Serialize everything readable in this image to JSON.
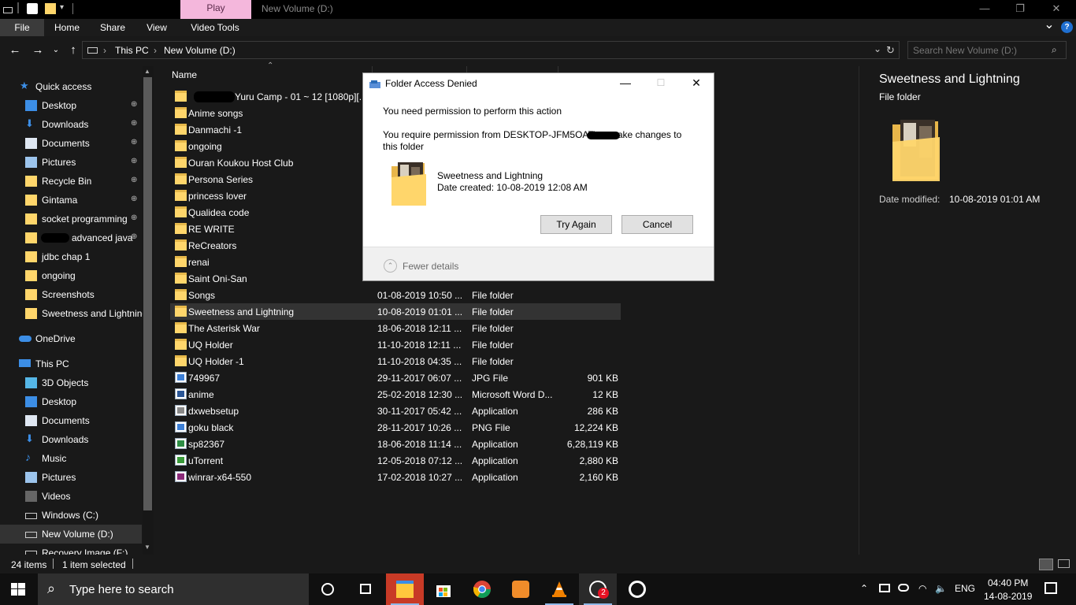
{
  "titlebar": {
    "context_tab": "Play",
    "window_title": "New Volume (D:)",
    "minimize_glyph": "—",
    "maximize_glyph": "❐",
    "close_glyph": "✕"
  },
  "ribbon": {
    "tabs": [
      "File",
      "Home",
      "Share",
      "View",
      "Video Tools"
    ],
    "expand_glyph": "⌄",
    "help_glyph": "?"
  },
  "address": {
    "crumbs": [
      "This PC",
      "New Volume (D:)"
    ],
    "separator": "›",
    "search_placeholder": "Search New Volume (D:)"
  },
  "nav": {
    "quick_access": "Quick access",
    "quick_items": [
      {
        "label": "Desktop",
        "icon": "desktop-icon"
      },
      {
        "label": "Downloads",
        "icon": "downloads-icon"
      },
      {
        "label": "Documents",
        "icon": "documents-icon"
      },
      {
        "label": "Pictures",
        "icon": "pictures-icon"
      },
      {
        "label": "Recycle Bin",
        "icon": "folder-icon"
      },
      {
        "label": "Gintama",
        "icon": "folder-icon"
      },
      {
        "label": "socket programming",
        "icon": "folder-icon"
      },
      {
        "label": "advanced java",
        "icon": "folder-icon"
      },
      {
        "label": "jdbc chap 1",
        "icon": "folder-icon"
      },
      {
        "label": "ongoing",
        "icon": "folder-icon"
      },
      {
        "label": "Screenshots",
        "icon": "folder-icon"
      },
      {
        "label": "Sweetness and Lightning",
        "icon": "folder-icon"
      }
    ],
    "onedrive": "OneDrive",
    "this_pc": "This PC",
    "pc_items": [
      {
        "label": "3D Objects",
        "icon": "3d-objects-icon"
      },
      {
        "label": "Desktop",
        "icon": "desktop-icon"
      },
      {
        "label": "Documents",
        "icon": "documents-icon"
      },
      {
        "label": "Downloads",
        "icon": "downloads-icon"
      },
      {
        "label": "Music",
        "icon": "music-icon"
      },
      {
        "label": "Pictures",
        "icon": "pictures-icon"
      },
      {
        "label": "Videos",
        "icon": "videos-icon"
      },
      {
        "label": "Windows (C:)",
        "icon": "drive-icon"
      },
      {
        "label": "New Volume (D:)",
        "icon": "drive-icon"
      },
      {
        "label": "Recovery Image (F:)",
        "icon": "drive-icon"
      }
    ],
    "pin_glyph": "📌"
  },
  "filelist": {
    "column_name": "Name",
    "rows": [
      {
        "name": "Yuru Camp - 01 ~ 12 [1080p][...",
        "date": "",
        "type": "",
        "size": "",
        "kind": "folder"
      },
      {
        "name": "Anime songs",
        "date": "",
        "type": "",
        "size": "",
        "kind": "folder"
      },
      {
        "name": "Danmachi -1",
        "date": "",
        "type": "",
        "size": "",
        "kind": "folder"
      },
      {
        "name": "ongoing",
        "date": "",
        "type": "",
        "size": "",
        "kind": "folder"
      },
      {
        "name": "Ouran Koukou Host Club",
        "date": "",
        "type": "",
        "size": "",
        "kind": "folder"
      },
      {
        "name": "Persona Series",
        "date": "",
        "type": "",
        "size": "",
        "kind": "folder"
      },
      {
        "name": "princess lover",
        "date": "",
        "type": "",
        "size": "",
        "kind": "folder"
      },
      {
        "name": "Qualidea code",
        "date": "",
        "type": "",
        "size": "",
        "kind": "folder"
      },
      {
        "name": "RE WRITE",
        "date": "",
        "type": "",
        "size": "",
        "kind": "folder"
      },
      {
        "name": "ReCreators",
        "date": "",
        "type": "",
        "size": "",
        "kind": "folder"
      },
      {
        "name": "renai",
        "date": "",
        "type": "",
        "size": "",
        "kind": "folder"
      },
      {
        "name": "Saint Oni-San",
        "date": "",
        "type": "",
        "size": "",
        "kind": "folder"
      },
      {
        "name": "Songs",
        "date": "01-08-2019 10:50 ...",
        "type": "File folder",
        "size": "",
        "kind": "folder"
      },
      {
        "name": "Sweetness and Lightning",
        "date": "10-08-2019 01:01 ...",
        "type": "File folder",
        "size": "",
        "kind": "folder"
      },
      {
        "name": "The Asterisk War",
        "date": "18-06-2018 12:11 ...",
        "type": "File folder",
        "size": "",
        "kind": "folder"
      },
      {
        "name": "UQ Holder",
        "date": "11-10-2018 12:11 ...",
        "type": "File folder",
        "size": "",
        "kind": "folder"
      },
      {
        "name": "UQ Holder -1",
        "date": "11-10-2018 04:35 ...",
        "type": "File folder",
        "size": "",
        "kind": "folder"
      },
      {
        "name": "749967",
        "date": "29-11-2017 06:07 ...",
        "type": "JPG File",
        "size": "901 KB",
        "kind": "file"
      },
      {
        "name": "anime",
        "date": "25-02-2018 12:30 ...",
        "type": "Microsoft Word D...",
        "size": "12 KB",
        "kind": "file"
      },
      {
        "name": "dxwebsetup",
        "date": "30-11-2017 05:42 ...",
        "type": "Application",
        "size": "286 KB",
        "kind": "file"
      },
      {
        "name": "goku black",
        "date": "28-11-2017 10:26 ...",
        "type": "PNG File",
        "size": "12,224 KB",
        "kind": "file"
      },
      {
        "name": "sp82367",
        "date": "18-06-2018 11:14 ...",
        "type": "Application",
        "size": "6,28,119 KB",
        "kind": "file"
      },
      {
        "name": "uTorrent",
        "date": "12-05-2018 07:12 ...",
        "type": "Application",
        "size": "2,880 KB",
        "kind": "file"
      },
      {
        "name": "winrar-x64-550",
        "date": "17-02-2018 10:27 ...",
        "type": "Application",
        "size": "2,160 KB",
        "kind": "file"
      }
    ]
  },
  "details": {
    "title": "Sweetness and Lightning",
    "type": "File folder",
    "modified_label": "Date modified:",
    "modified_value": "10-08-2019 01:01 AM"
  },
  "status": {
    "items": "24 items",
    "selected": "1 item selected"
  },
  "dialog": {
    "title": "Folder Access Denied",
    "message1": "You need permission to perform this action",
    "message2": "You require permission from DESKTOP-JFM5OAT\\ to make changes to this folder",
    "folder_name": "Sweetness and Lightning",
    "date_created": "Date created: 10-08-2019 12:08 AM",
    "try_again": "Try Again",
    "cancel": "Cancel",
    "fewer_details": "Fewer details",
    "fewer_glyph": "⌃"
  },
  "taskbar": {
    "search_placeholder": "Type here to search",
    "badge": "2",
    "lang": "ENG",
    "time": "04:40 PM",
    "date": "14-08-2019"
  },
  "colors": {
    "background": "#191919",
    "context_tab": "#f4b7dc",
    "folder": "#ffd66b",
    "selection": "#333333",
    "dialog_bg": "#ffffff"
  }
}
